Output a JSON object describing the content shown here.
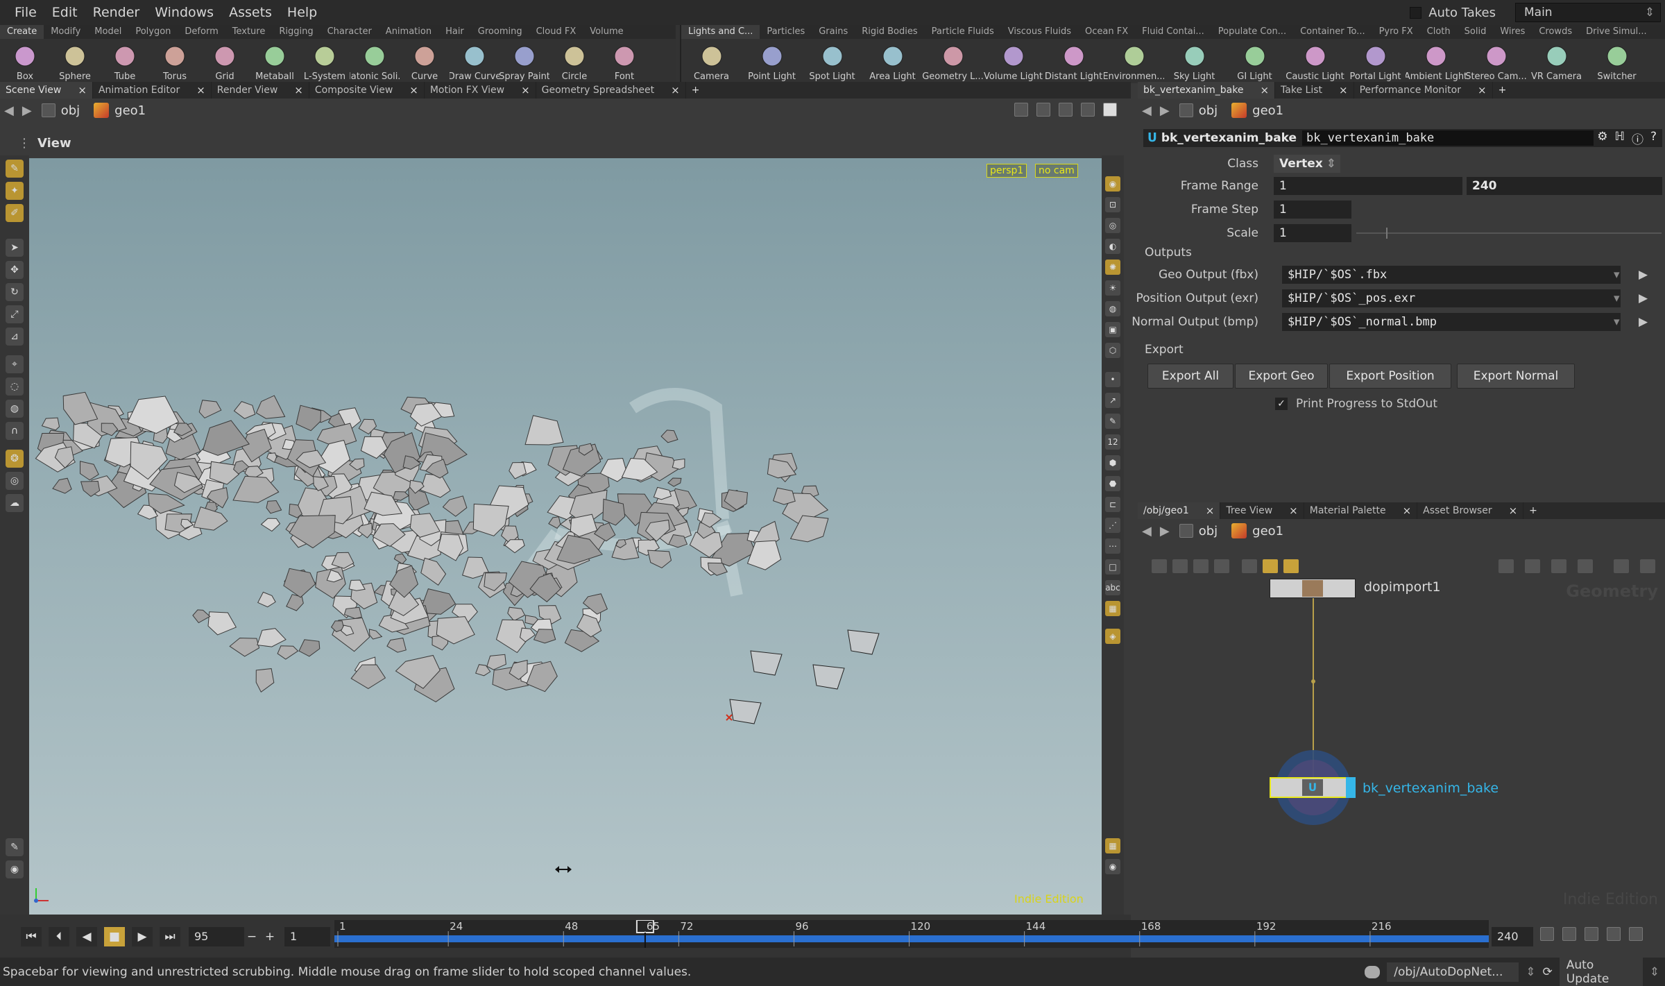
{
  "menu": [
    "File",
    "Edit",
    "Render",
    "Windows",
    "Assets",
    "Help"
  ],
  "auto_takes": "Auto Takes",
  "desktop": "Main",
  "shelf_left": {
    "tabs": [
      "Create",
      "Modify",
      "Model",
      "Polygon",
      "Deform",
      "Texture",
      "Rigging",
      "Character",
      "Animation",
      "Hair",
      "Grooming",
      "Cloud FX",
      "Volume"
    ],
    "tools": [
      {
        "label": "Box",
        "icon": "box-icon"
      },
      {
        "label": "Sphere",
        "icon": "sphere-icon"
      },
      {
        "label": "Tube",
        "icon": "tube-icon"
      },
      {
        "label": "Torus",
        "icon": "torus-icon"
      },
      {
        "label": "Grid",
        "icon": "grid-icon"
      },
      {
        "label": "Metaball",
        "icon": "metaball-icon"
      },
      {
        "label": "L-System",
        "icon": "lsystem-icon"
      },
      {
        "label": "Platonic Soli...",
        "icon": "platonic-icon"
      },
      {
        "label": "Curve",
        "icon": "curve-icon"
      },
      {
        "label": "Draw Curve",
        "icon": "draw-curve-icon"
      },
      {
        "label": "Spray Paint",
        "icon": "spray-paint-icon"
      },
      {
        "label": "Circle",
        "icon": "circle-icon"
      },
      {
        "label": "Font",
        "icon": "font-icon"
      }
    ]
  },
  "shelf_right": {
    "tabs": [
      "Lights and C...",
      "Particles",
      "Grains",
      "Rigid Bodies",
      "Particle Fluids",
      "Viscous Fluids",
      "Ocean FX",
      "Fluid Contai...",
      "Populate Con...",
      "Container To...",
      "Pyro FX",
      "Cloth",
      "Solid",
      "Wires",
      "Crowds",
      "Drive Simul..."
    ],
    "tools": [
      {
        "label": "Camera",
        "icon": "camera-icon"
      },
      {
        "label": "Point Light",
        "icon": "point-light-icon"
      },
      {
        "label": "Spot Light",
        "icon": "spot-light-icon"
      },
      {
        "label": "Area Light",
        "icon": "area-light-icon"
      },
      {
        "label": "Geometry L...",
        "icon": "geometry-light-icon"
      },
      {
        "label": "Volume Light",
        "icon": "volume-light-icon"
      },
      {
        "label": "Distant Light",
        "icon": "distant-light-icon"
      },
      {
        "label": "Environmen...",
        "icon": "environment-light-icon"
      },
      {
        "label": "Sky Light",
        "icon": "sky-light-icon"
      },
      {
        "label": "GI Light",
        "icon": "gi-light-icon"
      },
      {
        "label": "Caustic Light",
        "icon": "caustic-light-icon"
      },
      {
        "label": "Portal Light",
        "icon": "portal-light-icon"
      },
      {
        "label": "Ambient Light",
        "icon": "ambient-light-icon"
      },
      {
        "label": "Stereo Cam...",
        "icon": "stereo-camera-icon"
      },
      {
        "label": "VR Camera",
        "icon": "vr-camera-icon"
      },
      {
        "label": "Switcher",
        "icon": "switcher-icon"
      }
    ]
  },
  "left_panel": {
    "tabs": [
      "Scene View",
      "Animation Editor",
      "Render View",
      "Composite View",
      "Motion FX View",
      "Geometry Spreadsheet"
    ],
    "path": [
      "obj",
      "geo1"
    ],
    "view_title": "View",
    "cam_tags": [
      "persp1",
      "no cam"
    ],
    "indie": "Indie Edition"
  },
  "timeline": {
    "current_frame": "95",
    "step": "1",
    "end": "240",
    "ticks": [
      "1",
      "24",
      "48",
      "65",
      "72",
      "96",
      "120",
      "144",
      "168",
      "192",
      "216"
    ],
    "range_start": 1,
    "range_end": 240,
    "playhead_frame": 65
  },
  "status": {
    "message": "Spacebar for viewing and unrestricted scrubbing. Middle mouse drag on frame slider to hold scoped channel values.",
    "path": "/obj/AutoDopNet...",
    "update": "Auto Update"
  },
  "param_panel": {
    "tabs": [
      "bk_vertexanim_bake",
      "Take List",
      "Performance Monitor"
    ],
    "path": [
      "obj",
      "geo1"
    ],
    "node_type": "bk_vertexanim_bake",
    "node_name": "bk_vertexanim_bake",
    "class_label": "Class",
    "class_value": "Vertex",
    "frame_range_label": "Frame Range",
    "frame_range": [
      "1",
      "240"
    ],
    "frame_step_label": "Frame Step",
    "frame_step": "1",
    "scale_label": "Scale",
    "scale": "1",
    "outputs_label": "Outputs",
    "geo_label": "Geo Output (fbx)",
    "geo_value": "$HIP/`$OS`.fbx",
    "pos_label": "Position Output (exr)",
    "pos_value": "$HIP/`$OS`_pos.exr",
    "normal_label": "Normal Output (bmp)",
    "normal_value": "$HIP/`$OS`_normal.bmp",
    "export_label": "Export",
    "buttons": [
      "Export All",
      "Export Geo",
      "Export Position",
      "Export Normal"
    ],
    "print_label": "Print Progress to StdOut"
  },
  "network_panel": {
    "tabs": [
      "/obj/geo1",
      "Tree View",
      "Material Palette",
      "Asset Browser"
    ],
    "path": [
      "obj",
      "geo1"
    ],
    "watermark": "Geometry",
    "indie": "Indie Edition",
    "nodes": [
      "dopimport1",
      "bk_vertexanim_bake"
    ]
  },
  "colors": {
    "accent_yellow": "#d8d31a",
    "timeline_blue": "#2a6fd0",
    "selected_cyan": "#35b6e8"
  }
}
